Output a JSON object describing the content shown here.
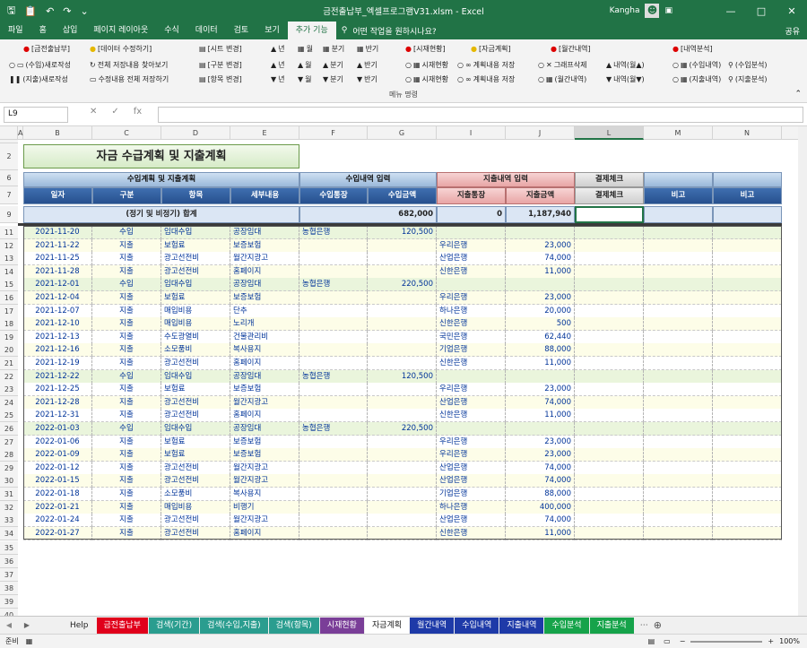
{
  "window": {
    "title": "금전출납부_엑셀프로그램V31.xlsm  -  Excel",
    "user": "Kangha"
  },
  "ribbon_tabs": [
    "파일",
    "홈",
    "삽입",
    "페이지 레이아웃",
    "수식",
    "데이터",
    "검토",
    "보기",
    "추가 기능"
  ],
  "active_tab": "추가 기능",
  "tell_me": "어떤 작업을 원하시나요?",
  "share": "공유",
  "ribbon": {
    "row1": [
      "[금전출납부]",
      "[데이터 수정하기]",
      "[시트 변경]",
      "년",
      "월",
      "분기",
      "반기",
      "[시재현황]",
      "[자금계획]",
      "[월간내역]",
      "[내역분석]"
    ],
    "row2": [
      "(수입)새로작성",
      "전체 저장내용 찾아보기",
      "[구분 변경]",
      "년",
      "월",
      "분기",
      "반기",
      "시재현황",
      "계획내용 저장",
      "그래프삭제",
      "내역(월▲)",
      "(수입내역)",
      "(수입분석)"
    ],
    "row3": [
      "(지출)새로작성",
      "수정내용 전체 저장하기",
      "[항목 변경]",
      "년",
      "월",
      "분기",
      "반기",
      "시재현황",
      "계획내용 저장",
      "(월간내역)",
      "내역(월▼)",
      "(지출내역)",
      "(지출분석)"
    ],
    "group_label": "메뉴 명령"
  },
  "namebox": "L9",
  "columns": [
    "A",
    "B",
    "C",
    "D",
    "E",
    "F",
    "G",
    "I",
    "J",
    "L",
    "M",
    "N"
  ],
  "sheet": {
    "title": "자금 수급계획 및 지출계획",
    "hdr_plan": "수입계획 및 지출계획",
    "hdr_income": "수입내역 입력",
    "hdr_expense": "지출내역 입력",
    "hdr_check": "결제체크",
    "sub": [
      "일자",
      "구분",
      "항목",
      "세부내용",
      "수입통장",
      "수입금액",
      "지출통장",
      "지출금액",
      "결제체크",
      "비고",
      "비고"
    ],
    "total_label": "(정기 및 비정기) 합계",
    "total_income": "682,000",
    "total_expense_count": "0",
    "total_expense": "1,187,940",
    "rows": [
      [
        "11",
        "2021-11-20",
        "수입",
        "임대수입",
        "공장임대",
        "농협은행",
        "120,500",
        "",
        ""
      ],
      [
        "12",
        "2021-11-22",
        "지출",
        "보험료",
        "보증보험",
        "",
        "",
        "우리은행",
        "23,000"
      ],
      [
        "13",
        "2021-11-25",
        "지출",
        "광고선전비",
        "월간지광고",
        "",
        "",
        "산업은행",
        "74,000"
      ],
      [
        "14",
        "2021-11-28",
        "지출",
        "광고선전비",
        "홈페이지",
        "",
        "",
        "신한은행",
        "11,000"
      ],
      [
        "15",
        "2021-12-01",
        "수입",
        "임대수입",
        "공장임대",
        "농협은행",
        "220,500",
        "",
        ""
      ],
      [
        "16",
        "2021-12-04",
        "지출",
        "보험료",
        "보증보험",
        "",
        "",
        "우리은행",
        "23,000"
      ],
      [
        "17",
        "2021-12-07",
        "지출",
        "매입비용",
        "단추",
        "",
        "",
        "하나은행",
        "20,000"
      ],
      [
        "18",
        "2021-12-10",
        "지출",
        "매입비용",
        "노리개",
        "",
        "",
        "신한은행",
        "500"
      ],
      [
        "19",
        "2021-12-13",
        "지출",
        "수도광열비",
        "건물관리비",
        "",
        "",
        "국민은행",
        "62,440"
      ],
      [
        "20",
        "2021-12-16",
        "지출",
        "소모품비",
        "복사용지",
        "",
        "",
        "기업은행",
        "88,000"
      ],
      [
        "21",
        "2021-12-19",
        "지출",
        "광고선전비",
        "홈페이지",
        "",
        "",
        "신한은행",
        "11,000"
      ],
      [
        "22",
        "2021-12-22",
        "수입",
        "임대수입",
        "공장임대",
        "농협은행",
        "120,500",
        "",
        ""
      ],
      [
        "23",
        "2021-12-25",
        "지출",
        "보험료",
        "보증보험",
        "",
        "",
        "우리은행",
        "23,000"
      ],
      [
        "24",
        "2021-12-28",
        "지출",
        "광고선전비",
        "월간지광고",
        "",
        "",
        "산업은행",
        "74,000"
      ],
      [
        "25",
        "2021-12-31",
        "지출",
        "광고선전비",
        "홈페이지",
        "",
        "",
        "신한은행",
        "11,000"
      ],
      [
        "26",
        "2022-01-03",
        "수입",
        "임대수입",
        "공장임대",
        "농협은행",
        "220,500",
        "",
        ""
      ],
      [
        "27",
        "2022-01-06",
        "지출",
        "보험료",
        "보증보험",
        "",
        "",
        "우리은행",
        "23,000"
      ],
      [
        "28",
        "2022-01-09",
        "지출",
        "보험료",
        "보증보험",
        "",
        "",
        "우리은행",
        "23,000"
      ],
      [
        "29",
        "2022-01-12",
        "지출",
        "광고선전비",
        "월간지광고",
        "",
        "",
        "산업은행",
        "74,000"
      ],
      [
        "30",
        "2022-01-15",
        "지출",
        "광고선전비",
        "월간지광고",
        "",
        "",
        "산업은행",
        "74,000"
      ],
      [
        "31",
        "2022-01-18",
        "지출",
        "소모품비",
        "복사용지",
        "",
        "",
        "기업은행",
        "88,000"
      ],
      [
        "32",
        "2022-01-21",
        "지출",
        "매입비용",
        "비행기",
        "",
        "",
        "하나은행",
        "400,000"
      ],
      [
        "33",
        "2022-01-24",
        "지출",
        "광고선전비",
        "월간지광고",
        "",
        "",
        "산업은행",
        "74,000"
      ],
      [
        "34",
        "2022-01-27",
        "지출",
        "광고선전비",
        "홈페이지",
        "",
        "",
        "신한은행",
        "11,000"
      ]
    ],
    "empty_rows": [
      "35",
      "36",
      "37",
      "38",
      "39",
      "40",
      "41",
      "42",
      "43",
      "44",
      "45",
      "46",
      "47",
      "48",
      "49",
      "50"
    ]
  },
  "sheet_tabs": [
    {
      "label": "Help",
      "color": "#f0f0f0",
      "text": "#222"
    },
    {
      "label": "금전출납부",
      "color": "#e0001b",
      "text": "#fff"
    },
    {
      "label": "검색(기간)",
      "color": "#2a9d8f",
      "text": "#fff"
    },
    {
      "label": "검색(수입,지출)",
      "color": "#2a9d8f",
      "text": "#fff"
    },
    {
      "label": "검색(항목)",
      "color": "#2a9d8f",
      "text": "#fff"
    },
    {
      "label": "시재현황",
      "color": "#7a3e98",
      "text": "#fff"
    },
    {
      "label": "자금계획",
      "color": "#ffffff",
      "text": "#222"
    },
    {
      "label": "월간내역",
      "color": "#1e3aa8",
      "text": "#fff"
    },
    {
      "label": "수입내역",
      "color": "#1e3aa8",
      "text": "#fff"
    },
    {
      "label": "지출내역",
      "color": "#1e3aa8",
      "text": "#fff"
    },
    {
      "label": "수입분석",
      "color": "#16a34a",
      "text": "#fff"
    },
    {
      "label": "지출분석",
      "color": "#16a34a",
      "text": "#fff"
    }
  ],
  "status": {
    "left": "준비",
    "zoom": "100%"
  }
}
